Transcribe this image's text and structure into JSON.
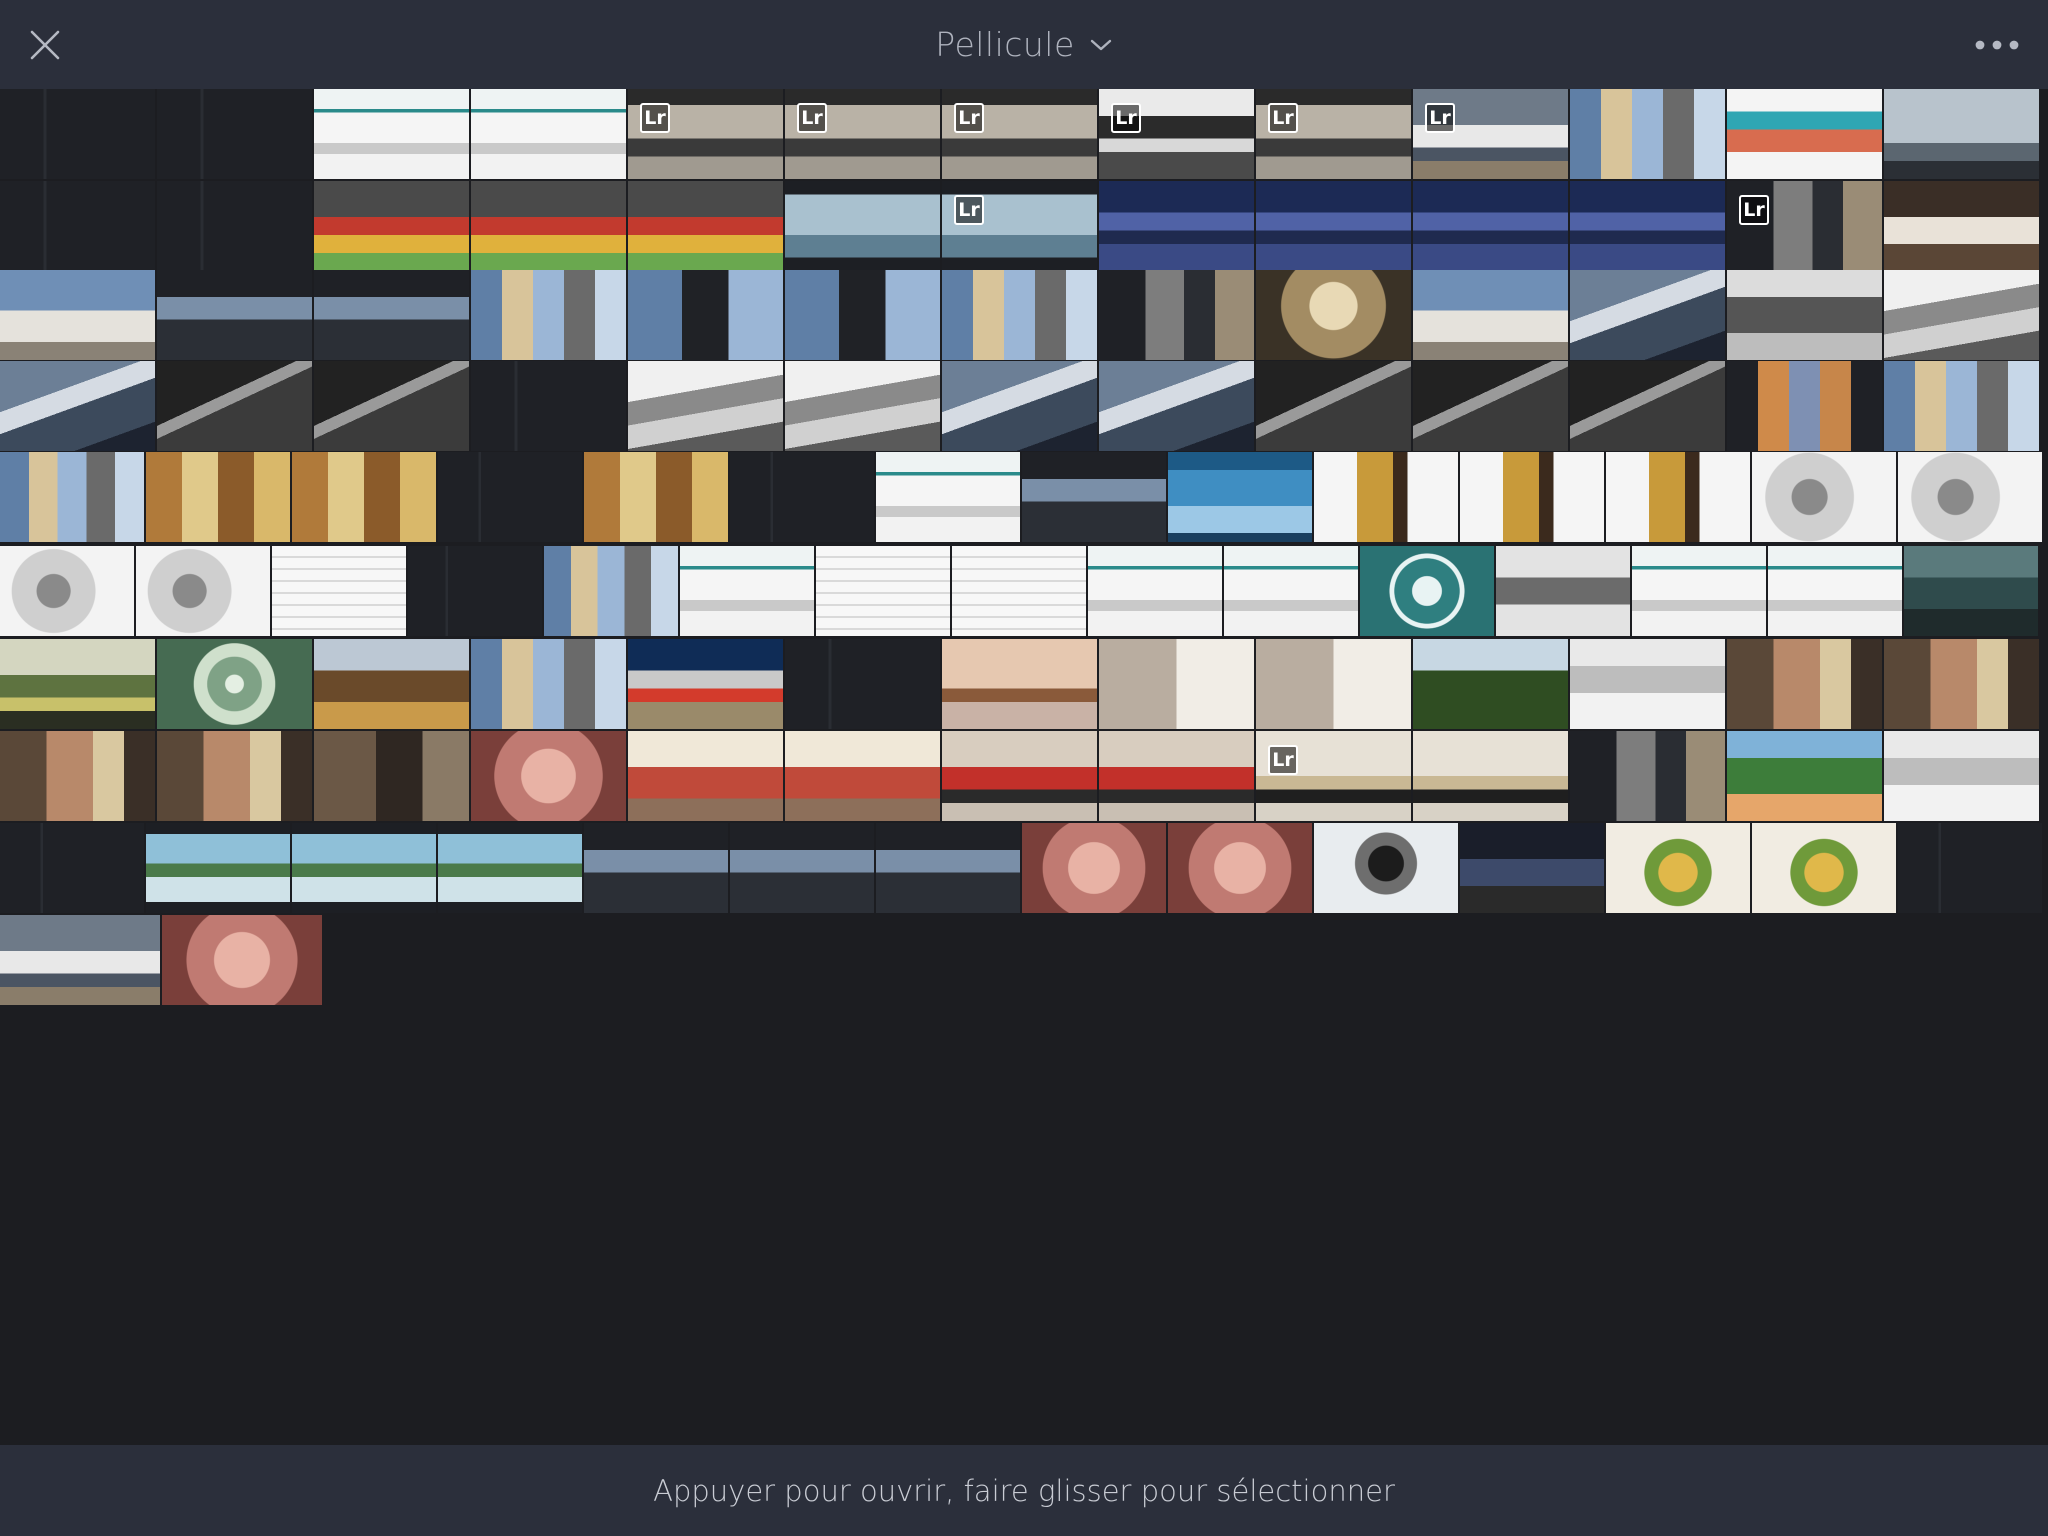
{
  "header": {
    "title": "Pellicule",
    "close_icon": "close-icon",
    "dropdown_icon": "chevron-down-icon",
    "more_icon": "more-icon"
  },
  "footer": {
    "hint": "Appuyer pour ouvrir, faire glisser pour sélectionner"
  },
  "badge_text": "Lr",
  "colors": {
    "bar_background": "#2b2f3b",
    "grid_background": "#1c1d21",
    "title_text": "#aeb2bd",
    "hint_text": "#c9ccd4"
  },
  "grid": {
    "rows": [
      [
        {
          "t": "dark"
        },
        {
          "t": "dark"
        },
        {
          "t": "web"
        },
        {
          "t": "web"
        },
        {
          "t": "ship",
          "lr": true
        },
        {
          "t": "ship",
          "lr": true
        },
        {
          "t": "ship",
          "lr": true
        },
        {
          "t": "shipwhite",
          "lr": true
        },
        {
          "t": "ship",
          "lr": true
        },
        {
          "t": "plane",
          "lr": true
        },
        {
          "t": "collage"
        },
        {
          "t": "webportrait"
        },
        {
          "t": "burj"
        }
      ],
      [
        {
          "t": "dark"
        },
        {
          "t": "dark"
        },
        {
          "t": "food"
        },
        {
          "t": "food"
        },
        {
          "t": "food"
        },
        {
          "t": "sea"
        },
        {
          "t": "sea",
          "lr": true
        },
        {
          "t": "city"
        },
        {
          "t": "city"
        },
        {
          "t": "city"
        },
        {
          "t": "city"
        },
        {
          "t": "darkcollage",
          "lr": true
        },
        {
          "t": "wedding"
        }
      ],
      [
        {
          "t": "mosque"
        },
        {
          "t": "darkpanorama"
        },
        {
          "t": "darkpanorama"
        },
        {
          "t": "collage"
        },
        {
          "t": "collagepanel"
        },
        {
          "t": "collagepanel"
        },
        {
          "t": "collage"
        },
        {
          "t": "darkcollage"
        },
        {
          "t": "arch"
        },
        {
          "t": "mosque"
        },
        {
          "t": "tower"
        },
        {
          "t": "bwcity"
        },
        {
          "t": "dune"
        }
      ],
      [
        {
          "t": "tower"
        },
        {
          "t": "bwtower"
        },
        {
          "t": "bwtower"
        },
        {
          "t": "dark"
        },
        {
          "t": "dune"
        },
        {
          "t": "dune"
        },
        {
          "t": "tower"
        },
        {
          "t": "tower"
        },
        {
          "t": "bwtower"
        },
        {
          "t": "bwtower"
        },
        {
          "t": "bwtower"
        },
        {
          "t": "towers"
        },
        {
          "t": "collage"
        }
      ],
      [
        {
          "t": "collage"
        },
        {
          "t": "collageorange"
        },
        {
          "t": "collageorange"
        },
        {
          "t": "dark"
        },
        {
          "t": "collageorange"
        },
        {
          "t": "dark"
        },
        {
          "t": "web"
        },
        {
          "t": "darkpanorama"
        },
        {
          "t": "ipad"
        },
        {
          "t": "wine"
        },
        {
          "t": "wine"
        },
        {
          "t": "wine"
        },
        {
          "t": "blurwhite"
        },
        {
          "t": "blurwhite"
        }
      ],
      [
        {
          "t": "blurwhite"
        },
        {
          "t": "blurwhite"
        },
        {
          "t": "doc"
        },
        {
          "t": "dark"
        },
        {
          "t": "collage"
        },
        {
          "t": "web"
        },
        {
          "t": "doc"
        },
        {
          "t": "doc"
        },
        {
          "t": "web"
        },
        {
          "t": "web"
        },
        {
          "t": "logo"
        },
        {
          "t": "iconsgray"
        },
        {
          "t": "web"
        },
        {
          "t": "web"
        },
        {
          "t": "sealandscape"
        }
      ],
      [
        {
          "t": "boat"
        },
        {
          "t": "spiral"
        },
        {
          "t": "tallship"
        },
        {
          "t": "collage"
        },
        {
          "t": "car"
        },
        {
          "t": "dark"
        },
        {
          "t": "riverboat"
        },
        {
          "t": "wall"
        },
        {
          "t": "wall"
        },
        {
          "t": "forest"
        },
        {
          "t": "keyboard"
        },
        {
          "t": "selfie"
        },
        {
          "t": "selfie"
        }
      ],
      [
        {
          "t": "selfie"
        },
        {
          "t": "selfie"
        },
        {
          "t": "portrait"
        },
        {
          "t": "pinkface"
        },
        {
          "t": "kitchen"
        },
        {
          "t": "kitchen"
        },
        {
          "t": "cook"
        },
        {
          "t": "cook"
        },
        {
          "t": "pug",
          "lr": true
        },
        {
          "t": "pug"
        },
        {
          "t": "darkcollage"
        },
        {
          "t": "girl"
        },
        {
          "t": "keyboard"
        }
      ],
      [
        {
          "t": "dark"
        },
        {
          "t": "river"
        },
        {
          "t": "river"
        },
        {
          "t": "river"
        },
        {
          "t": "darkpanorama"
        },
        {
          "t": "darkpanorama"
        },
        {
          "t": "darkpanorama"
        },
        {
          "t": "pinkface"
        },
        {
          "t": "pinkface"
        },
        {
          "t": "camera"
        },
        {
          "t": "desk"
        },
        {
          "t": "plate"
        },
        {
          "t": "plate"
        },
        {
          "t": "dark"
        }
      ],
      [
        {
          "t": "plane"
        },
        {
          "t": "pinkface"
        }
      ]
    ]
  }
}
